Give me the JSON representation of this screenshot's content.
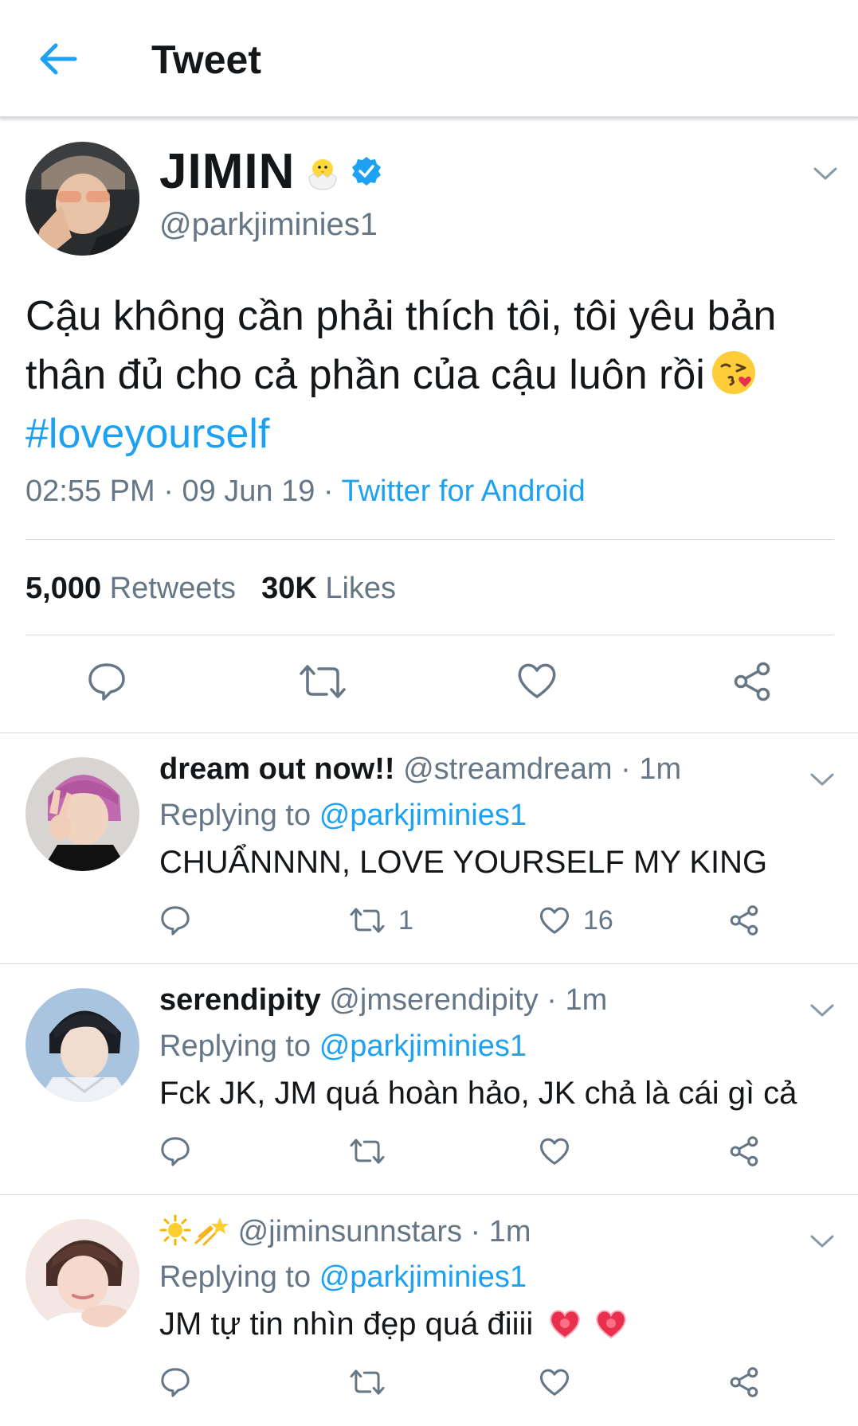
{
  "header": {
    "title": "Tweet"
  },
  "tweet": {
    "author_name": "JIMIN",
    "author_handle": "@parkjiminies1",
    "text": "Cậu không cần phải thích tôi, tôi yêu bản thân đủ cho cả phần của cậu luôn rồi",
    "hashtag": "#loveyourself",
    "time": "02:55 PM",
    "date": "09 Jun 19",
    "source": "Twitter for Android",
    "separator": " · ",
    "retweets_count": "5,000",
    "retweets_label": "Retweets",
    "likes_count": "30K",
    "likes_label": "Likes"
  },
  "replies": [
    {
      "name": "dream out now!!",
      "handle": "@streamdream",
      "time": "1m",
      "replying_label": "Replying to",
      "replying_to": "@parkjiminies1",
      "text": "CHUẨNNNN, LOVE YOURSELF MY KING",
      "retweets": "1",
      "likes": "16"
    },
    {
      "name": "serendipity",
      "handle": "@jmserendipity",
      "time": "1m",
      "replying_label": "Replying to",
      "replying_to": "@parkjiminies1",
      "text": "Fck JK, JM quá hoàn hảo, JK chả là cái gì cả",
      "retweets": "",
      "likes": ""
    },
    {
      "name": "",
      "handle": "@jiminsunnstars",
      "time": "1m",
      "replying_label": "Replying to",
      "replying_to": "@parkjiminies1",
      "text": "JM tự tin nhìn đẹp quá điiii",
      "retweets": "",
      "likes": ""
    }
  ],
  "colors": {
    "accent": "#1da1f2",
    "secondary_text": "#657786",
    "primary_text": "#14171a",
    "border": "#d5dade"
  },
  "icons": [
    "back-arrow-icon",
    "chick-emoji-icon",
    "verified-badge-icon",
    "chevron-down-icon",
    "reply-icon",
    "retweet-icon",
    "like-icon",
    "share-icon",
    "kiss-emoji-icon",
    "sun-emoji-icon",
    "shooting-star-emoji-icon",
    "heart-emoji-icon"
  ]
}
